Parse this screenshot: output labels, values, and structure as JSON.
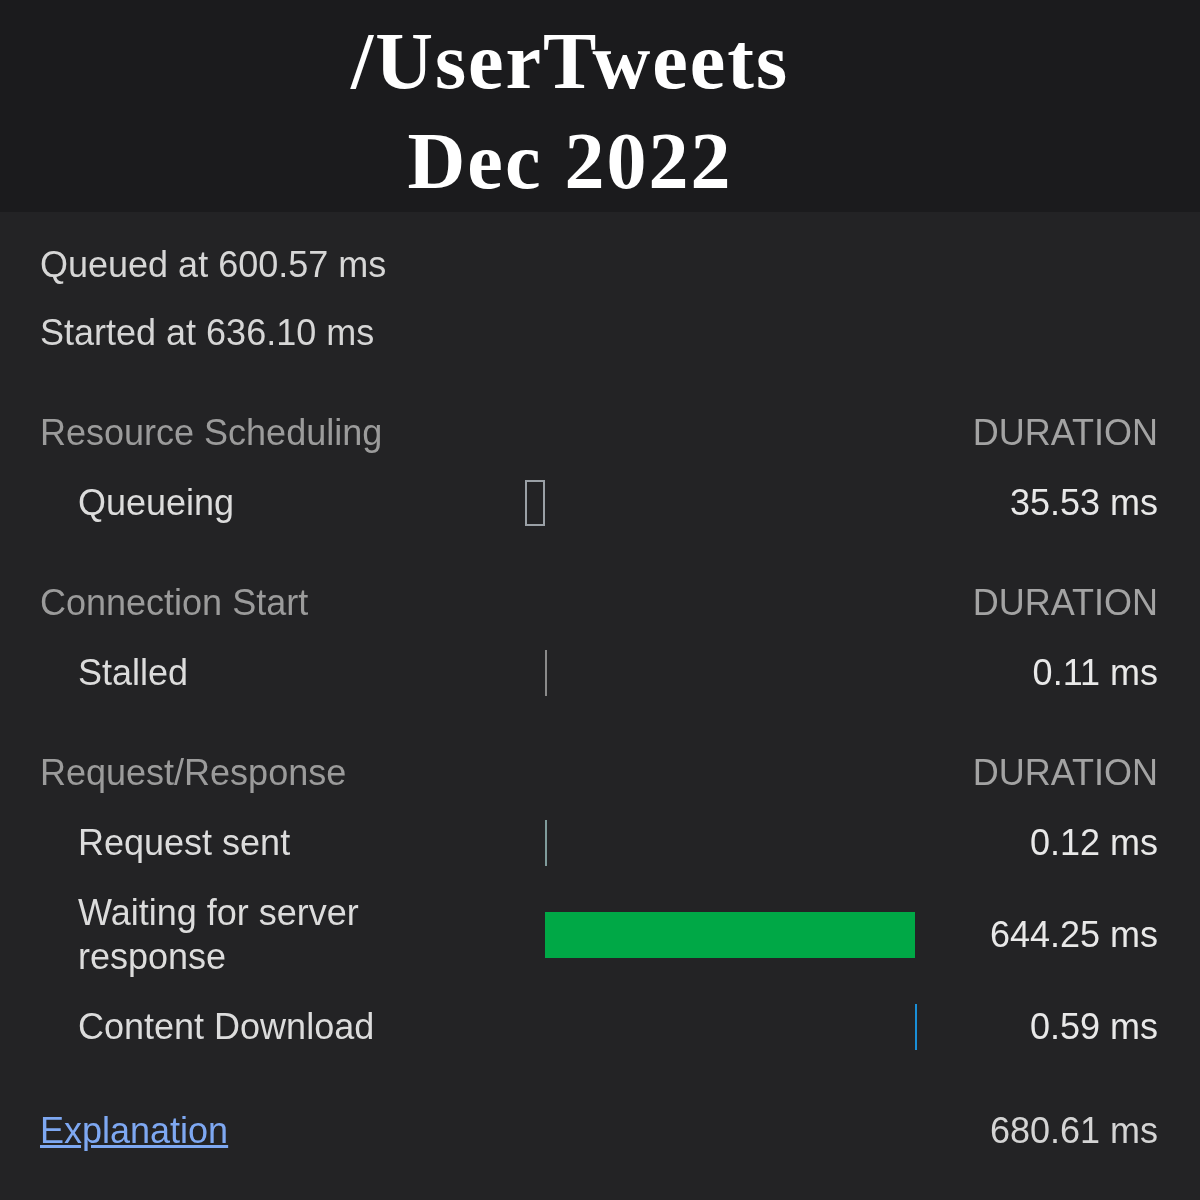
{
  "title": {
    "lines": [
      "/UserTweets",
      "Dec 2022"
    ]
  },
  "timing": {
    "queued_at": "Queued at 600.57 ms",
    "started_at": "Started at 636.10 ms",
    "sections": [
      {
        "title": "Resource Scheduling",
        "column_label": "DURATION",
        "phases": [
          {
            "label": "Queueing",
            "kind": "outline",
            "color": "#9aa0a6",
            "duration": "35.53 ms"
          }
        ]
      },
      {
        "title": "Connection Start",
        "column_label": "DURATION",
        "phases": [
          {
            "label": "Stalled",
            "kind": "solid",
            "color": "#8a8a8a",
            "duration": "0.11 ms"
          }
        ]
      },
      {
        "title": "Request/Response",
        "column_label": "DURATION",
        "phases": [
          {
            "label": "Request sent",
            "kind": "solid",
            "color": "#7f9b9b",
            "duration": "0.12 ms"
          },
          {
            "label": "Waiting for server response",
            "kind": "solid",
            "color": "#00a846",
            "duration": "644.25 ms"
          },
          {
            "label": "Content Download",
            "kind": "solid",
            "color": "#1a8fd8",
            "duration": "0.59 ms"
          }
        ]
      }
    ],
    "footer": {
      "link": "Explanation",
      "total": "680.61 ms"
    }
  }
}
